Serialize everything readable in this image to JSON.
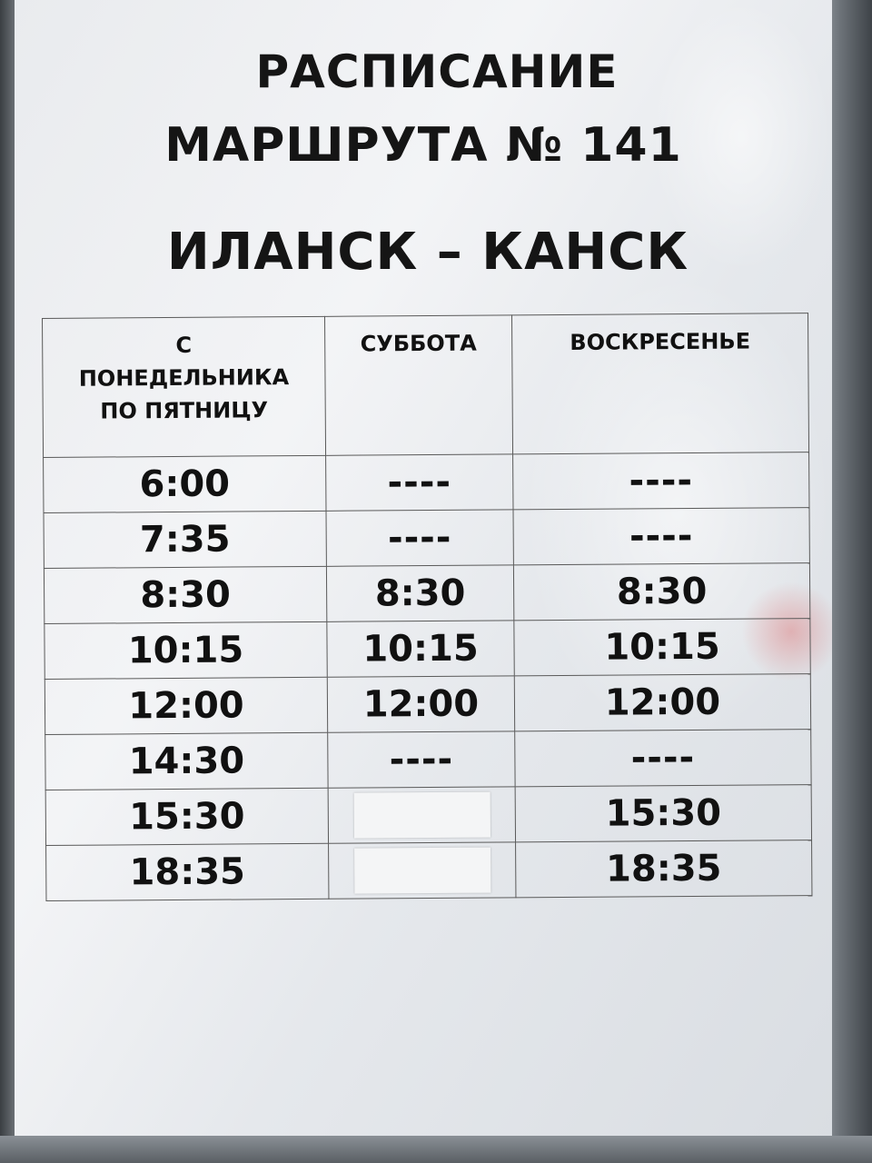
{
  "notice": {
    "title_line1": "РАСПИСАНИЕ",
    "title_line2": "МАРШРУТА № 141",
    "route": "ИЛАНСК – КАНСК"
  },
  "schedule": {
    "headers": [
      "С ПОНЕДЕЛЬНИКА ПО ПЯТНИЦУ",
      "СУББОТА",
      "ВОСКРЕСЕНЬЕ"
    ],
    "header_lines": {
      "weekday": [
        "С",
        "ПОНЕДЕЛЬНИКА",
        "ПО ПЯТНИЦУ"
      ]
    },
    "rows": [
      [
        "6:00",
        "----",
        "----"
      ],
      [
        "7:35",
        "----",
        "----"
      ],
      [
        "8:30",
        "8:30",
        "8:30"
      ],
      [
        "10:15",
        "10:15",
        "10:15"
      ],
      [
        "12:00",
        "12:00",
        "12:00"
      ],
      [
        "14:30",
        "----",
        "----"
      ],
      [
        "15:30",
        "",
        "15:30"
      ],
      [
        "18:35",
        "",
        "18:35"
      ]
    ]
  }
}
